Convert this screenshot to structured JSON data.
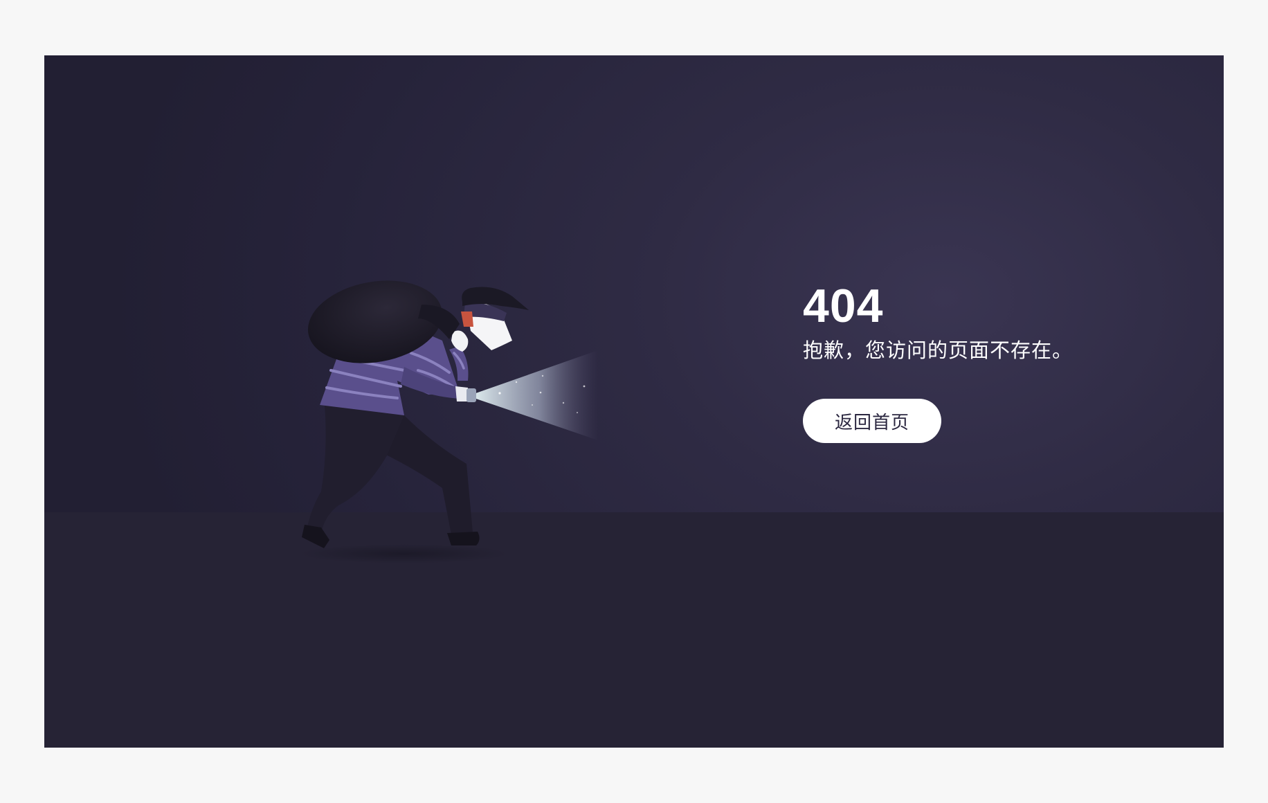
{
  "error_page": {
    "code": "404",
    "message": "抱歉，您访问的页面不存在。",
    "home_button_label": "返回首页"
  },
  "illustration": {
    "subject": "thief-with-flashlight",
    "shirt_color": "#5a4f8c",
    "stripe_color": "#8b82bf",
    "dark_color": "#1d1a29",
    "light_color": "#e8f6f6"
  },
  "colors": {
    "background": "#2f2b44",
    "floor": "#262335",
    "frame": "#f7f7f7",
    "text": "#ffffff",
    "button_bg": "#ffffff",
    "button_text": "#2b2740"
  }
}
